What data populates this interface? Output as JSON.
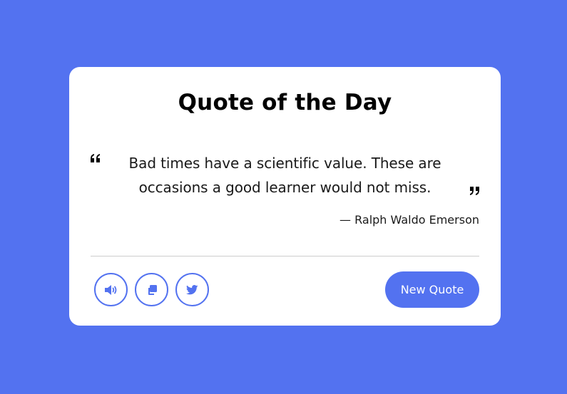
{
  "card": {
    "title": "Quote of the Day",
    "quote": "Bad times have a scientific value. These are occasions a good learner would not miss.",
    "author": "— Ralph Waldo Emerson"
  },
  "actions": {
    "icons": [
      "volume-icon",
      "copy-icon",
      "twitter-icon"
    ],
    "new_quote_label": "New Quote"
  },
  "colors": {
    "accent": "#5372f0",
    "card": "#ffffff",
    "text": "#1a1a1a",
    "divider": "#cccccc"
  }
}
